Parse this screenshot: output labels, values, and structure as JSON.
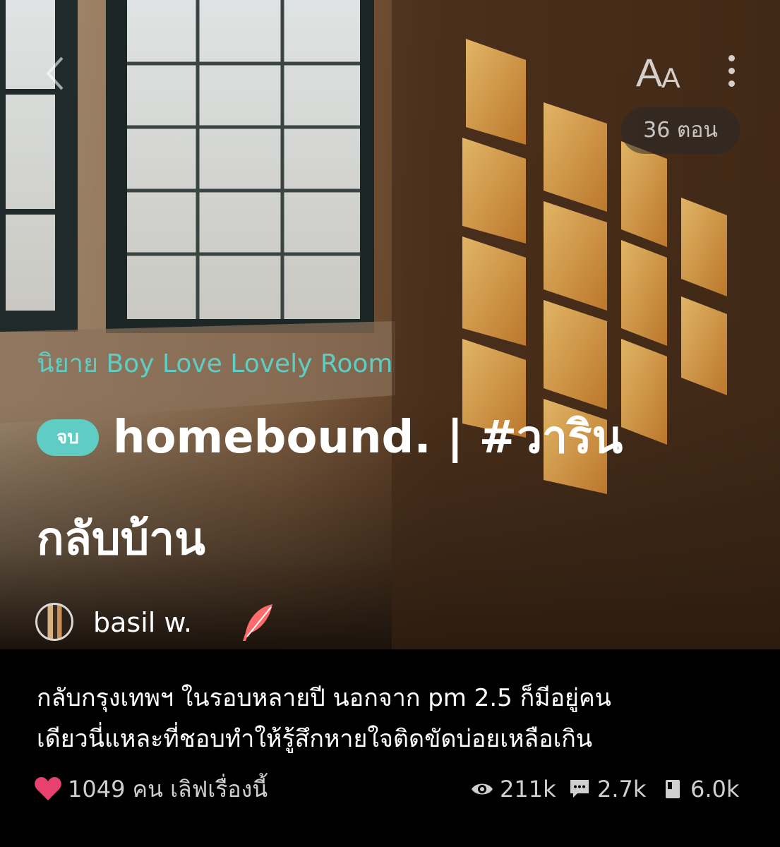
{
  "header": {
    "back_icon": "chevron-left-icon",
    "font_size_big": "A",
    "font_size_small": "A",
    "more_icon": "vertical-dots-icon",
    "episodes_label": "36 ตอน"
  },
  "story": {
    "category": "นิยาย Boy Love Lovely Room",
    "status_badge": "จบ",
    "title_line1": "homebound. | #วาริน",
    "title_line2": "กลับบ้าน",
    "author": "basil w.",
    "author_badge_icon": "quill-icon",
    "synopsis": [
      "กลับกรุงเทพฯ ในรอบหลายปี นอกจาก pm 2.5 ก็มีอยู่คน",
      "เดียวนี่แหละที่ชอบทำให้รู้สึกหายใจติดขัดบ่อยเหลือเกิน"
    ]
  },
  "stats": {
    "love_text": "1049 คน เลิฟเรื่องนี้",
    "views": "211k",
    "comments": "2.7k",
    "chapters": "6.0k"
  },
  "colors": {
    "accent": "#5fcdc3",
    "heart": "#e8416f",
    "quill": "#ff6b6b"
  }
}
